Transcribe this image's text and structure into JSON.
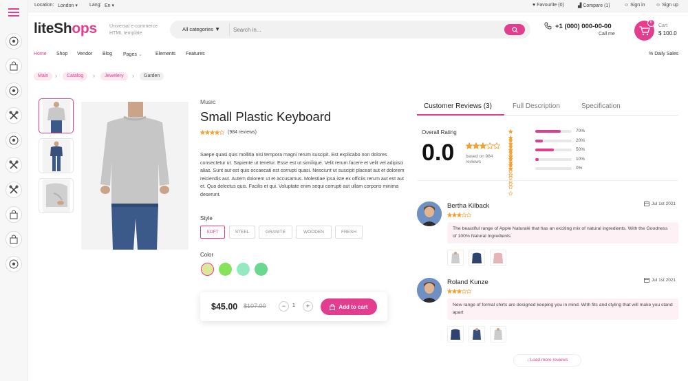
{
  "topbar": {
    "location_label": "Location:",
    "location_value": "London",
    "lang_label": "Lang:",
    "lang_value": "En",
    "favourite": "Favourite (0)",
    "compare": "Compare (1)",
    "sign_in": "Sign in",
    "sign_up": "Sign up"
  },
  "header": {
    "logo_part1": "liteSh",
    "logo_part2": "ps",
    "tagline": "Universal e-commerce HTML template",
    "category_select": "All categories",
    "search_placeholder": "Search in...",
    "phone": "+1 (000) 000-00-00",
    "phone_sub": "Call me",
    "cart_count": "0",
    "cart_label": "Cart",
    "cart_total": "$ 100.0"
  },
  "nav": {
    "items": [
      "Home",
      "Shop",
      "Vendor",
      "Blog",
      "Pages",
      "Elements",
      "Features"
    ],
    "daily_sales": "Daily Sales",
    "active_color": "#e23d8e"
  },
  "breadcrumbs": [
    "Main",
    "Catalog",
    "Jewelery",
    "Garden"
  ],
  "sidebar": {
    "icons": [
      "menu-icon",
      "soccer-ball-icon",
      "shopping-bag-icon",
      "soccer-ball-icon",
      "tools-icon",
      "soccer-ball-icon",
      "tools-icon",
      "tools-icon",
      "shopping-bag-icon",
      "shopping-bag-icon",
      "soccer-ball-icon"
    ]
  },
  "product": {
    "category": "Music",
    "title": "Small Plastic Keyboard",
    "rating": 4,
    "review_count": "(984 reviews)",
    "description": "Saepe quasi quis mollitia nisi tempora magni rerum suscipit. Est explicabo non dolores consectetur ut. Sapiente ut tenetur. Esse est ut similique. Velit rerum facere et velit vel adipisci alias. Sunt aut est quis occaecati est corrupti quasi. Nesciunt ut suscipit placeat aut et dolorem reiciendis aut. Autem dolorem ut et accusamus. Molestiae ipsa iste ex officiis rerum aut est aut et. Quo delectus quis. Facilis et qui. Voluptate enim sequi corrupti aut ullam corporis minima deserunt.",
    "style_label": "Style",
    "styles": [
      "SOFT",
      "STEEL",
      "GRANITE",
      "WOODEN",
      "FRESH"
    ],
    "selected_style": "SOFT",
    "color_label": "Color",
    "colors": [
      "#dfe89a",
      "#86e25a",
      "#93eabe",
      "#6ad98f"
    ],
    "price": "$45.00",
    "old_price": "$107.00",
    "quantity": "1",
    "add_to_cart": "Add to cart",
    "accent": "#e23d8e"
  },
  "reviews": {
    "tabs": [
      "Customer Reviews (3)",
      "Full Description",
      "Specification"
    ],
    "overall_label": "Overall Rating",
    "overall_score": "0.0",
    "overall_stars": 3,
    "based_on": "based on 984 reviews",
    "distribution": [
      {
        "stars": 5,
        "percent": "70%",
        "value": 70
      },
      {
        "stars": 4,
        "percent": "20%",
        "value": 20
      },
      {
        "stars": 3,
        "percent": "50%",
        "value": 50
      },
      {
        "stars": 2,
        "percent": "10%",
        "value": 10
      },
      {
        "stars": 1,
        "percent": "0%",
        "value": 0
      }
    ],
    "items": [
      {
        "name": "Bertha Kilback",
        "date": "Jul 1st 2021",
        "stars": 3,
        "text": "The beautiful range of Apple Naturalé that has an exciting mix of natural ingredients. With the Goodness of 100% Natural Ingredients"
      },
      {
        "name": "Roland Kunze",
        "date": "Jul 1st 2021",
        "stars": 3,
        "text": "New range of formal shirts are designed keeping you in mind. With fits and styling that will make you stand apart"
      }
    ],
    "load_more": "↓ Load more reviews"
  }
}
